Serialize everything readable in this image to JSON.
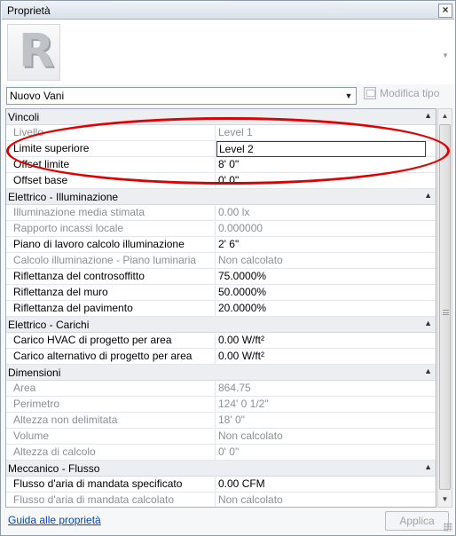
{
  "panel": {
    "title": "Proprietà",
    "close_glyph": "×",
    "logo_letter": "R",
    "type_selector": {
      "value": "Nuovo Vani"
    },
    "edit_type_label": "Modifica tipo",
    "help_link": "Guida alle proprietà",
    "apply_label": "Applica"
  },
  "groups": [
    {
      "name": "Vincoli",
      "rows": [
        {
          "name": "Livello",
          "value": "Level 1",
          "readonly": true
        },
        {
          "name": "Limite superiore",
          "value": "Level 2",
          "readonly": false,
          "editing": true
        },
        {
          "name": "Offset limite",
          "value": "8'  0\"",
          "readonly": false
        },
        {
          "name": "Offset base",
          "value": "0'  0\"",
          "readonly": false
        }
      ]
    },
    {
      "name": "Elettrico - Illuminazione",
      "rows": [
        {
          "name": "Illuminazione media stimata",
          "value": "0.00 lx",
          "readonly": true
        },
        {
          "name": "Rapporto incassi locale",
          "value": "0.000000",
          "readonly": true
        },
        {
          "name": "Piano di lavoro calcolo illuminazione",
          "value": "2'  6\"",
          "readonly": false
        },
        {
          "name": "Calcolo illuminazione - Piano luminaria",
          "value": "Non calcolato",
          "readonly": true
        },
        {
          "name": "Riflettanza del controsoffitto",
          "value": "75.0000%",
          "readonly": false
        },
        {
          "name": "Riflettanza del muro",
          "value": "50.0000%",
          "readonly": false
        },
        {
          "name": "Riflettanza del pavimento",
          "value": "20.0000%",
          "readonly": false
        }
      ]
    },
    {
      "name": "Elettrico - Carichi",
      "rows": [
        {
          "name": "Carico HVAC di progetto per area",
          "value": "0.00 W/ft²",
          "readonly": false
        },
        {
          "name": "Carico alternativo di progetto per area",
          "value": "0.00 W/ft²",
          "readonly": false
        }
      ]
    },
    {
      "name": "Dimensioni",
      "rows": [
        {
          "name": "Area",
          "value": "864.75",
          "readonly": true
        },
        {
          "name": "Perimetro",
          "value": "124'  0 1/2\"",
          "readonly": true
        },
        {
          "name": "Altezza non delimitata",
          "value": "18'  0\"",
          "readonly": true
        },
        {
          "name": "Volume",
          "value": "Non calcolato",
          "readonly": true
        },
        {
          "name": "Altezza di calcolo",
          "value": "0'  0\"",
          "readonly": true
        }
      ]
    },
    {
      "name": "Meccanico - Flusso",
      "rows": [
        {
          "name": "Flusso d'aria di mandata specificato",
          "value": "0.00 CFM",
          "readonly": false
        },
        {
          "name": "Flusso d'aria di mandata calcolato",
          "value": "Non calcolato",
          "readonly": true
        }
      ]
    }
  ],
  "icons": {
    "collapse": "collapse-icon",
    "dropdown": "chevron-down-icon",
    "close": "close-icon",
    "edit_type": "edit-type-icon"
  },
  "colors": {
    "highlight_annotation": "#e00000",
    "link": "#0645ad",
    "readonly_text": "#8a8f96"
  }
}
